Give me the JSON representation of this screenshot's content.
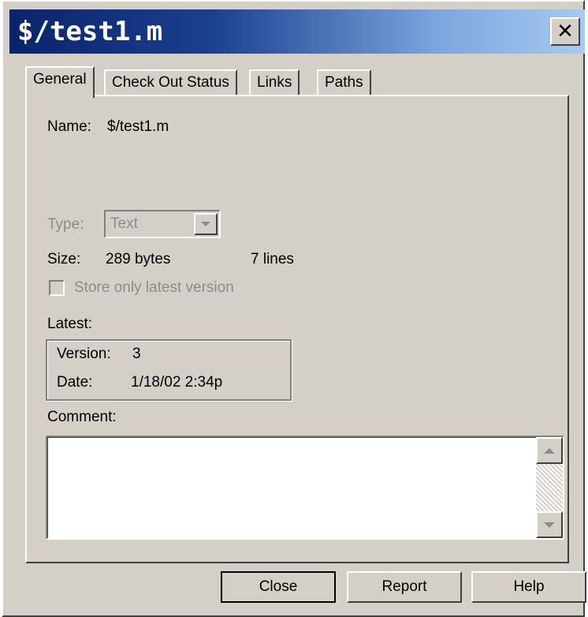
{
  "window": {
    "title": "$/test1.m",
    "close_glyph": "✕"
  },
  "tabs": [
    {
      "label": "General",
      "active": true
    },
    {
      "label": "Check Out Status",
      "active": false
    },
    {
      "label": "Links",
      "active": false
    },
    {
      "label": "Paths",
      "active": false
    }
  ],
  "general": {
    "name_label": "Name:",
    "name_value": "$/test1.m",
    "type_label": "Type:",
    "type_value": "Text",
    "size_label": "Size:",
    "size_bytes": "289 bytes",
    "size_lines": "7 lines",
    "store_latest_label": "Store only latest version",
    "store_latest_checked": false,
    "latest_label": "Latest:",
    "version_label": "Version:",
    "version_value": "3",
    "date_label": "Date:",
    "date_value": "1/18/02  2:34p",
    "comment_label": "Comment:",
    "comment_value": ""
  },
  "buttons": {
    "close": "Close",
    "report": "Report",
    "help": "Help"
  },
  "colors": {
    "face": "#d4d0c8",
    "titlebar_start": "#0a246a",
    "titlebar_end": "#a6caf0",
    "disabled_text": "#8c8c8c"
  }
}
